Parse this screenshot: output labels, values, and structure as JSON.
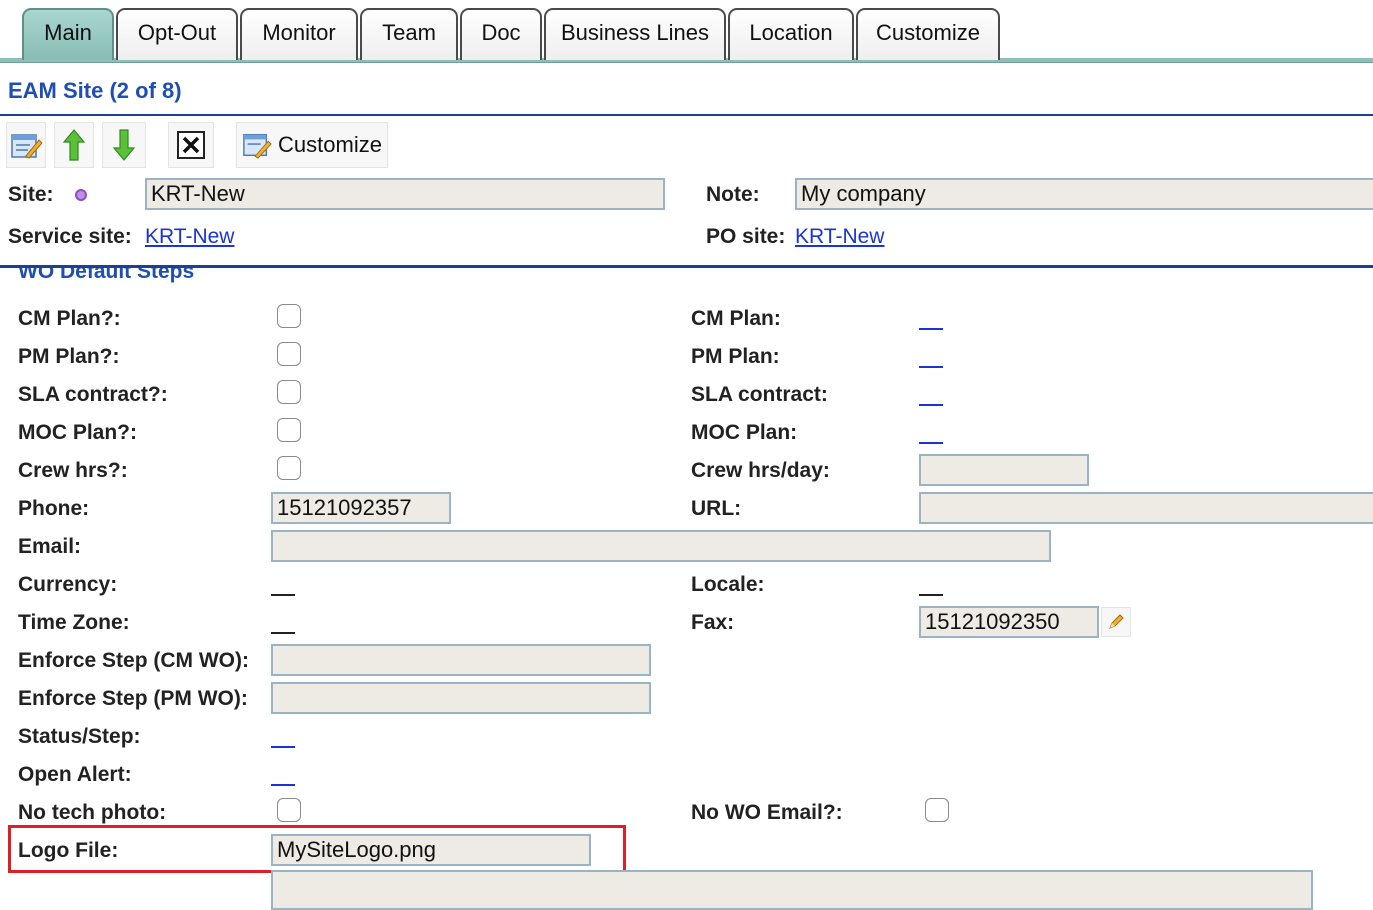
{
  "tabs": [
    {
      "label": "Main",
      "active": true
    },
    {
      "label": "Opt-Out"
    },
    {
      "label": "Monitor"
    },
    {
      "label": "Team"
    },
    {
      "label": "Doc"
    },
    {
      "label": "Business Lines"
    },
    {
      "label": "Location"
    },
    {
      "label": "Customize"
    }
  ],
  "header": {
    "title": "EAM Site (2 of 8)"
  },
  "toolbar": {
    "edit_icon": "edit-form-icon",
    "up_icon": "arrow-up-icon",
    "down_icon": "arrow-down-icon",
    "delete_icon": "close-box-icon",
    "customize_label": "Customize"
  },
  "top": {
    "site_label": "Site:",
    "site_value": "KRT-New",
    "note_label": "Note:",
    "note_value": "My company",
    "service_site_label": "Service site:",
    "service_site_value": "KRT-New",
    "po_site_label": "PO site:",
    "po_site_value": "KRT-New"
  },
  "section": {
    "title": "WO Default Steps"
  },
  "left_fields": {
    "cm_plan_q": "CM Plan?:",
    "pm_plan_q": "PM Plan?:",
    "sla_contract_q": "SLA contract?:",
    "moc_plan_q": "MOC Plan?:",
    "crew_hrs_q": "Crew hrs?:",
    "phone": "Phone:",
    "phone_value": "15121092357",
    "email": "Email:",
    "email_value": "",
    "currency": "Currency:",
    "time_zone": "Time Zone:",
    "enforce_cm": "Enforce Step (CM WO):",
    "enforce_pm": "Enforce Step (PM WO):",
    "status_step": "Status/Step:",
    "open_alert": "Open Alert:",
    "no_tech_photo": "No tech photo:",
    "logo_file": "Logo File:",
    "logo_file_value": "MySiteLogo.png"
  },
  "right_fields": {
    "cm_plan": "CM Plan:",
    "pm_plan": "PM Plan:",
    "sla_contract": "SLA contract:",
    "moc_plan": "MOC Plan:",
    "crew_hrs_day": "Crew hrs/day:",
    "crew_hrs_day_value": "",
    "url": "URL:",
    "url_value": "",
    "locale": "Locale:",
    "fax": "Fax:",
    "fax_value": "15121092350",
    "no_wo_email": "No WO Email?:"
  },
  "colors": {
    "accent": "#1f4fb5",
    "link": "#1a35d6",
    "active_tab": "#9ccac3",
    "highlight": "#e01e25",
    "input_bg": "#edebe4"
  }
}
